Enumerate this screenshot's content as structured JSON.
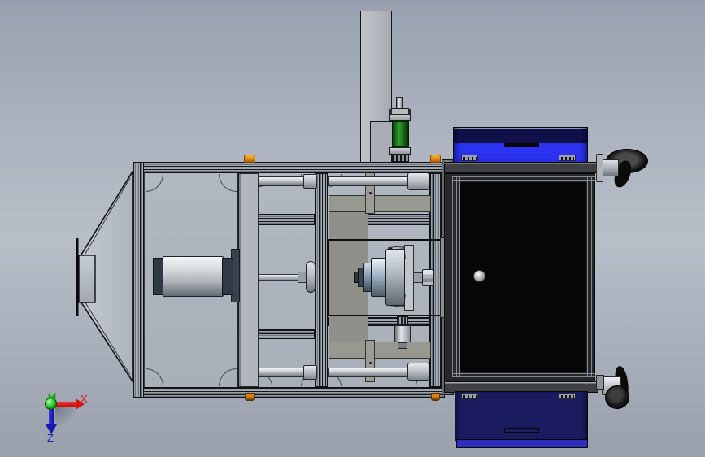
{
  "viewport": {
    "description_visible_text": "",
    "triad": {
      "x_label": "X",
      "z_label": "Z"
    }
  },
  "palette": {
    "background_top": "#98a0af",
    "background_middle": "#b8bec8",
    "background_bottom": "#99a0ac",
    "frame_interior": "#aeb4be",
    "extrusion_dark_line": "#141519",
    "extrusion_light_line": "#9aa0a8",
    "plate_gray": "#8f908a",
    "cylinder_end_cap": "#2e3a45",
    "metal_highlight": "#f0f2f4",
    "motor_green": "#1e8a1e",
    "accent_orange": "#e8920a",
    "cabinet_blue_bright": "#2b32f0",
    "cabinet_blue_dark_band": "#10104a",
    "cabinet_navy": "#1b1b60",
    "cabinet_navy_strip": "#2e2ebc",
    "cabinet_rail_gray": "#3e4044",
    "door_black": "#060607",
    "axis_x_red": "#d51414",
    "axis_z_blue": "#1818b8",
    "axis_origin_green": "#2fd42f"
  }
}
